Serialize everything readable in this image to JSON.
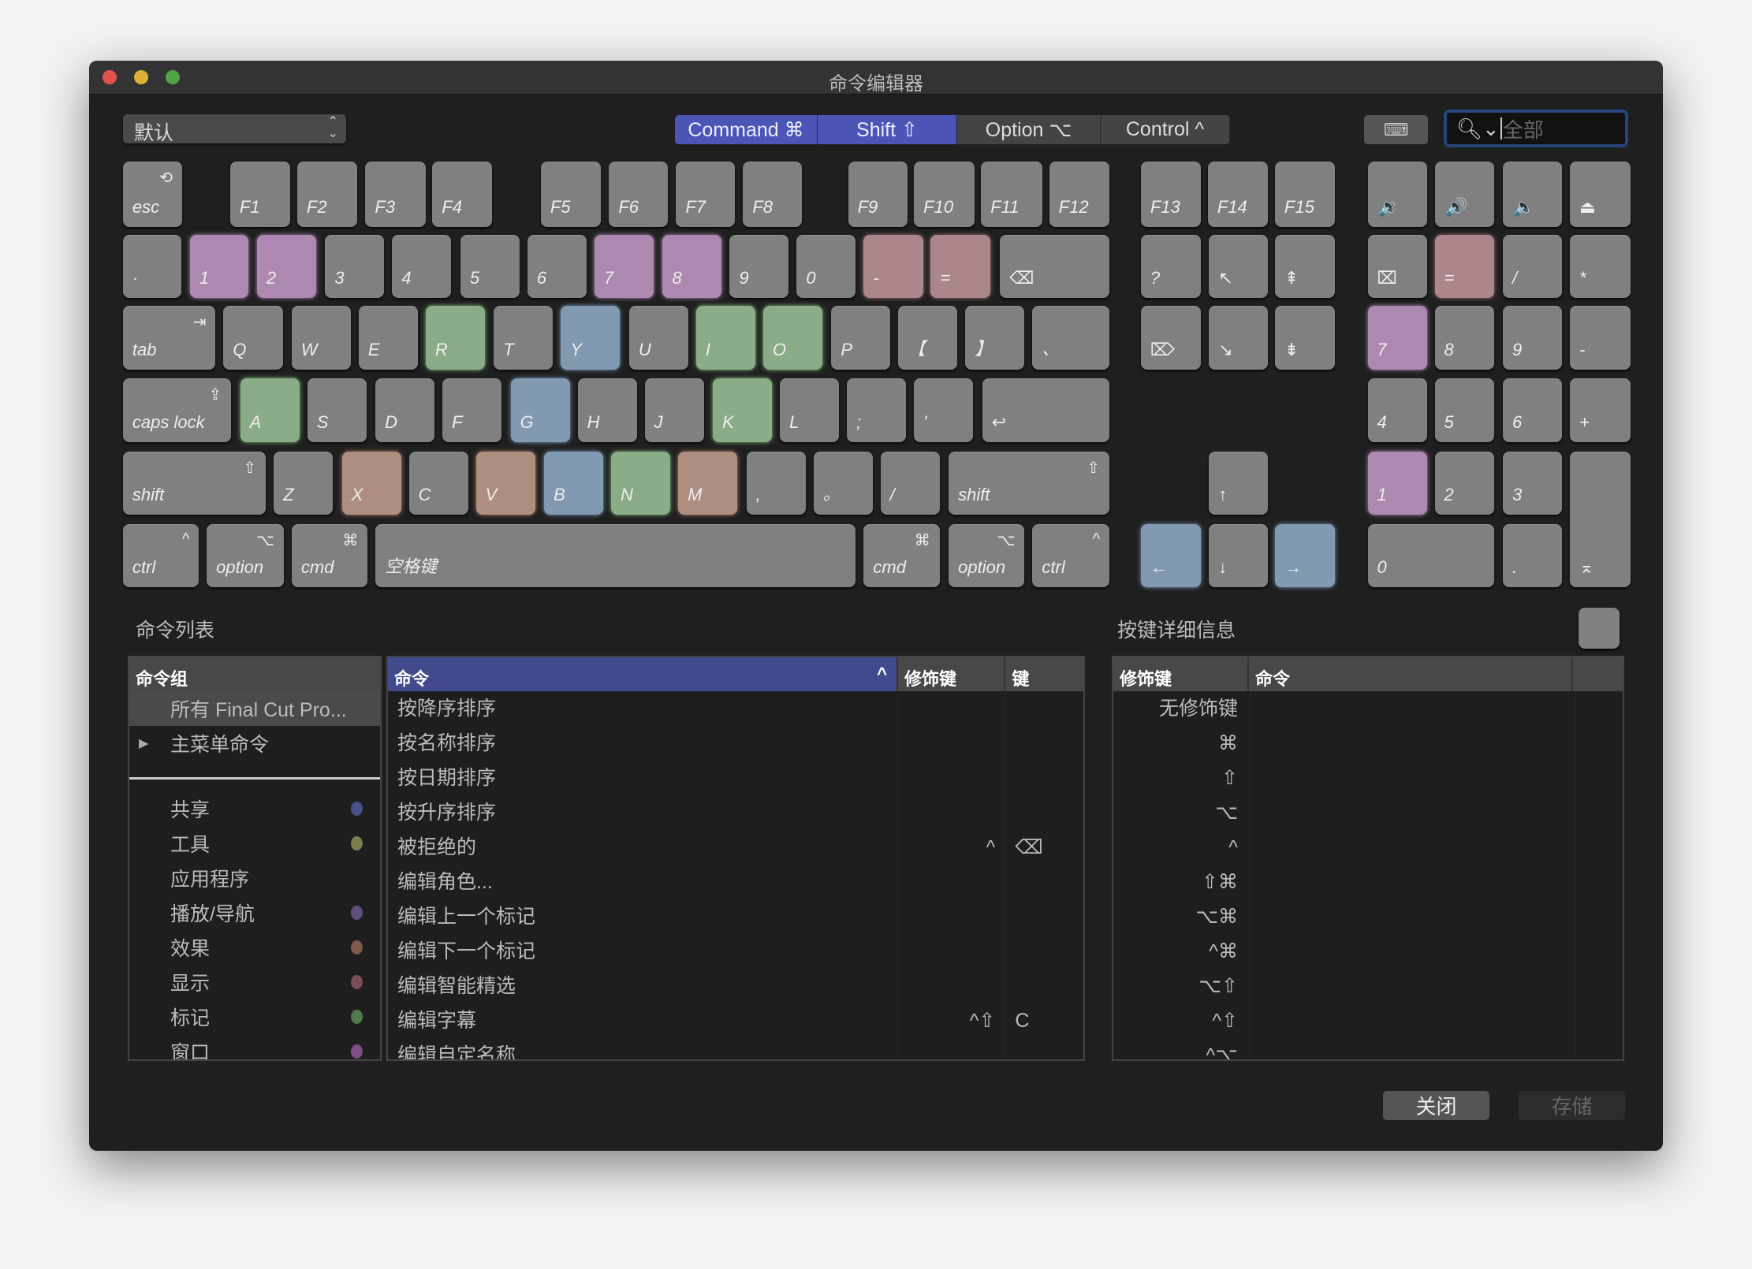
{
  "window": {
    "title": "命令编辑器",
    "lights": [
      "#e0524a",
      "#dfb037",
      "#4fa545"
    ]
  },
  "toolbar": {
    "preset": "默认",
    "modifiers": [
      {
        "label": "Command ⌘",
        "on": true
      },
      {
        "label": "Shift ⇧",
        "on": true
      },
      {
        "label": "Option ⌥",
        "on": false
      },
      {
        "label": "Control ^",
        "on": false
      }
    ],
    "keyboard_icon": "keyboard-icon",
    "search": {
      "placeholder": "全部",
      "icon": "search-icon"
    }
  },
  "colors": {
    "accent": "#4a55b5",
    "key": "#808080",
    "purple": "#ad88b0",
    "pink": "#ab868b",
    "green": "#8aac86",
    "blue": "#8299b2",
    "brown": "#ae8e80"
  },
  "keys": [
    {
      "l": "esc",
      "s": "⟲"
    },
    {
      "l": "F1"
    },
    {
      "l": "F2"
    },
    {
      "l": "F3"
    },
    {
      "l": "F4"
    },
    {
      "l": "F5"
    },
    {
      "l": "F6"
    },
    {
      "l": "F7"
    },
    {
      "l": "F8"
    },
    {
      "l": "F9"
    },
    {
      "l": "F10"
    },
    {
      "l": "F11"
    },
    {
      "l": "F12"
    },
    {
      "l": "F13"
    },
    {
      "l": "F14"
    },
    {
      "l": "F15"
    },
    {
      "l": "🔉"
    },
    {
      "l": "🔊"
    },
    {
      "l": "🔈"
    },
    {
      "l": "⏏"
    },
    {
      "l": "·"
    },
    {
      "l": "1",
      "h": "purple"
    },
    {
      "l": "2",
      "h": "purple"
    },
    {
      "l": "3"
    },
    {
      "l": "4"
    },
    {
      "l": "5"
    },
    {
      "l": "6"
    },
    {
      "l": "7",
      "h": "purple"
    },
    {
      "l": "8",
      "h": "purple"
    },
    {
      "l": "9"
    },
    {
      "l": "0"
    },
    {
      "l": "-",
      "h": "pink"
    },
    {
      "l": "=",
      "h": "pink"
    },
    {
      "l": "⌫"
    },
    {
      "l": "?"
    },
    {
      "l": "↖"
    },
    {
      "l": "⇞"
    },
    {
      "l": "⌧"
    },
    {
      "l": "=",
      "h": "pink"
    },
    {
      "l": "/"
    },
    {
      "l": "*"
    },
    {
      "l": "tab",
      "s": "⇥"
    },
    {
      "l": "Q"
    },
    {
      "l": "W"
    },
    {
      "l": "E"
    },
    {
      "l": "R",
      "h": "green"
    },
    {
      "l": "T"
    },
    {
      "l": "Y",
      "h": "blue"
    },
    {
      "l": "U"
    },
    {
      "l": "I",
      "h": "green"
    },
    {
      "l": "O",
      "h": "green"
    },
    {
      "l": "P"
    },
    {
      "l": "【"
    },
    {
      "l": "】"
    },
    {
      "l": "、"
    },
    {
      "l": "⌦"
    },
    {
      "l": "↘"
    },
    {
      "l": "⇟"
    },
    {
      "l": "7",
      "h": "purple"
    },
    {
      "l": "8"
    },
    {
      "l": "9"
    },
    {
      "l": "-"
    },
    {
      "l": "caps lock",
      "s": "⇪"
    },
    {
      "l": "A",
      "h": "green"
    },
    {
      "l": "S"
    },
    {
      "l": "D"
    },
    {
      "l": "F"
    },
    {
      "l": "G",
      "h": "blue"
    },
    {
      "l": "H"
    },
    {
      "l": "J"
    },
    {
      "l": "K",
      "h": "green"
    },
    {
      "l": "L"
    },
    {
      "l": ";"
    },
    {
      "l": "'"
    },
    {
      "l": "↩"
    },
    {
      "l": "4"
    },
    {
      "l": "5"
    },
    {
      "l": "6"
    },
    {
      "l": "+"
    },
    {
      "l": "shift",
      "s": "⇧"
    },
    {
      "l": "Z"
    },
    {
      "l": "X",
      "h": "brown"
    },
    {
      "l": "C"
    },
    {
      "l": "V",
      "h": "brown"
    },
    {
      "l": "B",
      "h": "blue"
    },
    {
      "l": "N",
      "h": "green"
    },
    {
      "l": "M",
      "h": "brown"
    },
    {
      "l": ","
    },
    {
      "l": "。"
    },
    {
      "l": "/"
    },
    {
      "l": "shift",
      "s": "⇧"
    },
    {
      "l": "↑"
    },
    {
      "l": "1",
      "h": "purple"
    },
    {
      "l": "2"
    },
    {
      "l": "3"
    },
    {
      "l": "⌅"
    },
    {
      "l": "ctrl",
      "s": "^"
    },
    {
      "l": "option",
      "s": "⌥"
    },
    {
      "l": "cmd",
      "s": "⌘"
    },
    {
      "l": "空格键"
    },
    {
      "l": "cmd",
      "s": "⌘"
    },
    {
      "l": "option",
      "s": "⌥"
    },
    {
      "l": "ctrl",
      "s": "^"
    },
    {
      "l": "←",
      "h": "blue"
    },
    {
      "l": "↓"
    },
    {
      "l": "→",
      "h": "blue"
    },
    {
      "l": "0"
    },
    {
      "l": "."
    }
  ],
  "command_list": {
    "title": "命令列表",
    "groups_header": "命令组",
    "groups_top": [
      {
        "label": "所有 Final Cut Pro...",
        "selected": true
      },
      {
        "label": "主菜单命令",
        "expand": "▶"
      }
    ],
    "groups": [
      {
        "label": "共享",
        "color": "#46508a"
      },
      {
        "label": "工具",
        "color": "#7f7d4e"
      },
      {
        "label": "应用程序"
      },
      {
        "label": "播放/导航",
        "color": "#624f80"
      },
      {
        "label": "效果",
        "color": "#7a5a48"
      },
      {
        "label": "显示",
        "color": "#7b4d57"
      },
      {
        "label": "标记",
        "color": "#4e7a4e"
      },
      {
        "label": "窗口",
        "color": "#7d4f80"
      }
    ],
    "columns": [
      "命令",
      "修饰键",
      "键"
    ],
    "sort_indicator": "^",
    "rows": [
      {
        "cmd": "按降序排序",
        "mod": "",
        "key": ""
      },
      {
        "cmd": "按名称排序",
        "mod": "",
        "key": ""
      },
      {
        "cmd": "按日期排序",
        "mod": "",
        "key": ""
      },
      {
        "cmd": "按升序排序",
        "mod": "",
        "key": ""
      },
      {
        "cmd": "被拒绝的",
        "mod": "^",
        "key": "⌫"
      },
      {
        "cmd": "编辑角色...",
        "mod": "",
        "key": ""
      },
      {
        "cmd": "编辑上一个标记",
        "mod": "",
        "key": ""
      },
      {
        "cmd": "编辑下一个标记",
        "mod": "",
        "key": ""
      },
      {
        "cmd": "编辑智能精选",
        "mod": "",
        "key": ""
      },
      {
        "cmd": "编辑字幕",
        "mod": "^⇧",
        "key": "C"
      },
      {
        "cmd": "编辑自定名称...",
        "mod": "",
        "key": ""
      }
    ]
  },
  "key_detail": {
    "title": "按键详细信息",
    "columns": [
      "修饰键",
      "命令"
    ],
    "rows": [
      "无修饰键",
      "⌘",
      "⇧",
      "⌥",
      "^",
      "⇧⌘",
      "⌥⌘",
      "^⌘",
      "⌥⇧",
      "^⇧",
      "^⌥"
    ]
  },
  "footer": {
    "close": "关闭",
    "save": "存储"
  }
}
